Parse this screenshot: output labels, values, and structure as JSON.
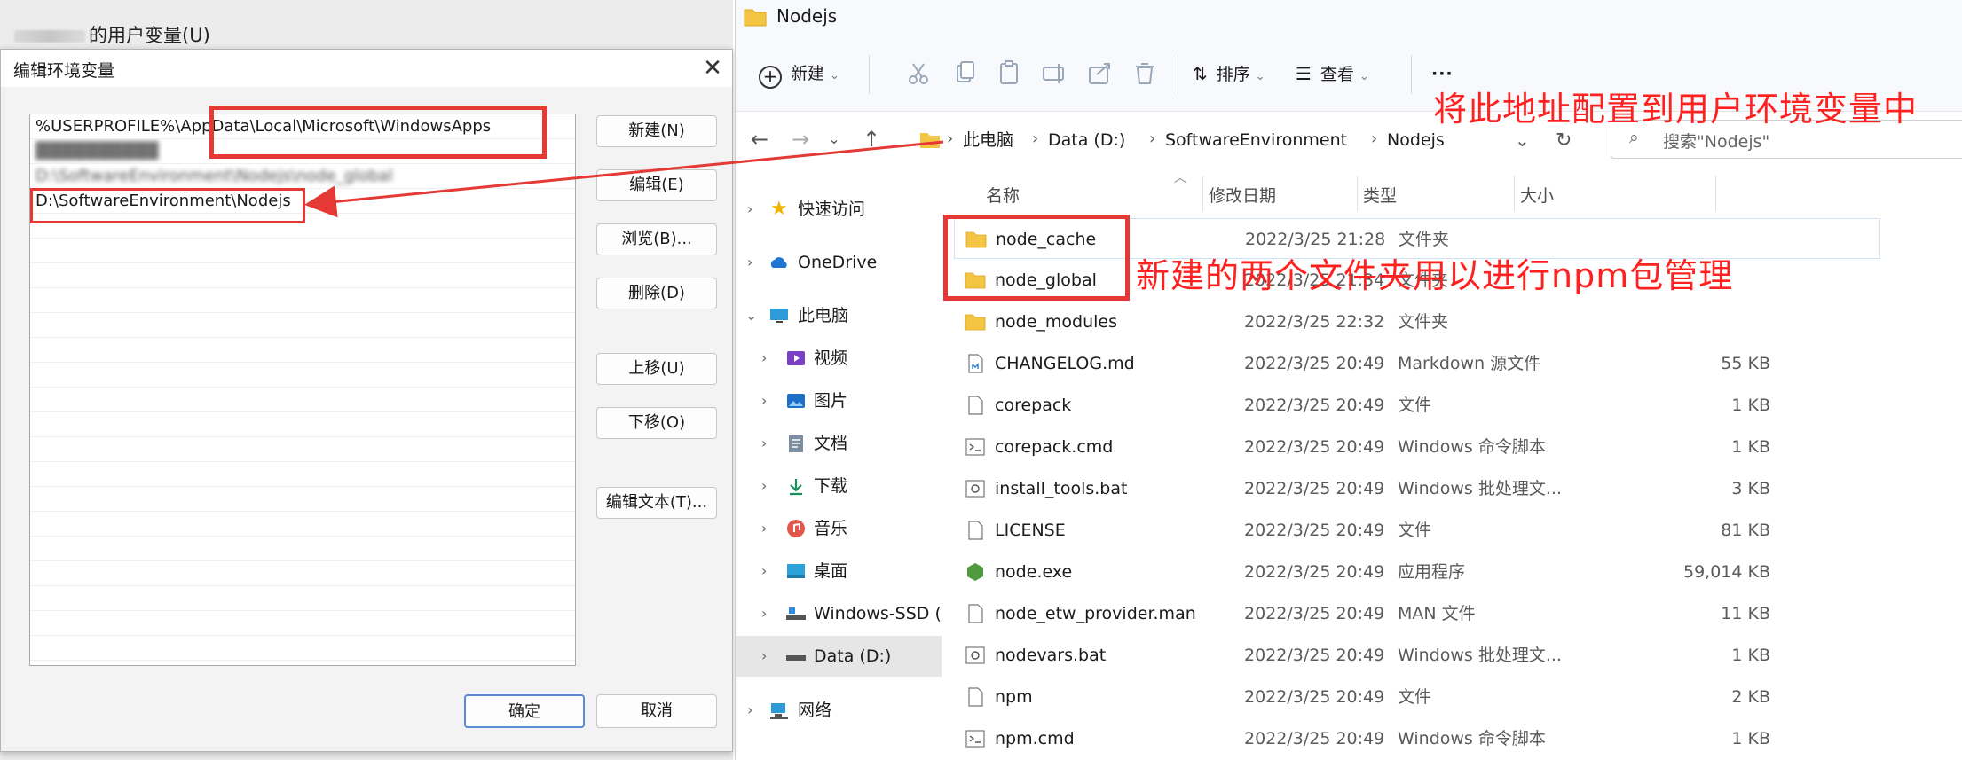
{
  "behind_window": {
    "title_suffix": "的用户变量(U)"
  },
  "dialog": {
    "title": "编辑环境变量",
    "close_glyph": "✕",
    "paths": [
      "%USERPROFILE%\\AppData\\Local\\Microsoft\\WindowsApps",
      "D:\\SoftwareEnvironment\\Nodejs\\node_global",
      "D:\\SoftwareEnvironment\\Nodejs"
    ],
    "buttons": {
      "new": "新建(N)",
      "edit": "编辑(E)",
      "browse": "浏览(B)...",
      "delete": "删除(D)",
      "move_up": "上移(U)",
      "move_down": "下移(O)",
      "edit_text": "编辑文本(T)..."
    },
    "ok": "确定",
    "cancel": "取消"
  },
  "explorer": {
    "title": "Nodejs",
    "toolbar": {
      "new": "新建",
      "sort": "排序",
      "view": "查看",
      "more": "···"
    },
    "breadcrumbs": [
      "此电脑",
      "Data (D:)",
      "SoftwareEnvironment",
      "Nodejs"
    ],
    "search_placeholder": "搜索\"Nodejs\"",
    "nav": [
      {
        "label": "快速访问",
        "icon": "star-icon"
      },
      {
        "label": "OneDrive",
        "icon": "cloud-icon"
      },
      {
        "label": "此电脑",
        "icon": "computer-icon"
      },
      {
        "label": "视频",
        "icon": "video-icon"
      },
      {
        "label": "图片",
        "icon": "picture-icon"
      },
      {
        "label": "文档",
        "icon": "document-icon"
      },
      {
        "label": "下载",
        "icon": "download-icon"
      },
      {
        "label": "音乐",
        "icon": "music-icon"
      },
      {
        "label": "桌面",
        "icon": "desktop-icon"
      },
      {
        "label": "Windows-SSD (C",
        "icon": "drive-icon"
      },
      {
        "label": "Data (D:)",
        "icon": "drive-icon"
      },
      {
        "label": "网络",
        "icon": "network-icon"
      }
    ],
    "columns": {
      "name": "名称",
      "date": "修改日期",
      "type": "类型",
      "size": "大小"
    },
    "files": [
      {
        "name": "node_cache",
        "date": "2022/3/25 21:28",
        "type": "文件夹",
        "size": "",
        "icon": "folder-icon"
      },
      {
        "name": "node_global",
        "date": "2022/3/25 21:34",
        "type": "文件夹",
        "size": "",
        "icon": "folder-icon"
      },
      {
        "name": "node_modules",
        "date": "2022/3/25 22:32",
        "type": "文件夹",
        "size": "",
        "icon": "folder-icon"
      },
      {
        "name": "CHANGELOG.md",
        "date": "2022/3/25 20:49",
        "type": "Markdown 源文件",
        "size": "55 KB",
        "icon": "markdown-file-icon"
      },
      {
        "name": "corepack",
        "date": "2022/3/25 20:49",
        "type": "文件",
        "size": "1 KB",
        "icon": "file-icon"
      },
      {
        "name": "corepack.cmd",
        "date": "2022/3/25 20:49",
        "type": "Windows 命令脚本",
        "size": "1 KB",
        "icon": "script-file-icon"
      },
      {
        "name": "install_tools.bat",
        "date": "2022/3/25 20:49",
        "type": "Windows 批处理文...",
        "size": "3 KB",
        "icon": "script-file-icon"
      },
      {
        "name": "LICENSE",
        "date": "2022/3/25 20:49",
        "type": "文件",
        "size": "81 KB",
        "icon": "file-icon"
      },
      {
        "name": "node.exe",
        "date": "2022/3/25 20:49",
        "type": "应用程序",
        "size": "59,014 KB",
        "icon": "node-exe-icon"
      },
      {
        "name": "node_etw_provider.man",
        "date": "2022/3/25 20:49",
        "type": "MAN 文件",
        "size": "11 KB",
        "icon": "file-icon"
      },
      {
        "name": "nodevars.bat",
        "date": "2022/3/25 20:49",
        "type": "Windows 批处理文...",
        "size": "1 KB",
        "icon": "script-file-icon"
      },
      {
        "name": "npm",
        "date": "2022/3/25 20:49",
        "type": "文件",
        "size": "2 KB",
        "icon": "file-icon"
      },
      {
        "name": "npm.cmd",
        "date": "2022/3/25 20:49",
        "type": "Windows 命令脚本",
        "size": "1 KB",
        "icon": "script-file-icon"
      }
    ]
  },
  "annotations": {
    "address_note": "将此地址配置到用户环境变量中",
    "folders_note": "新建的两个文件夹用以进行npm包管理",
    "color": "#e53935"
  }
}
